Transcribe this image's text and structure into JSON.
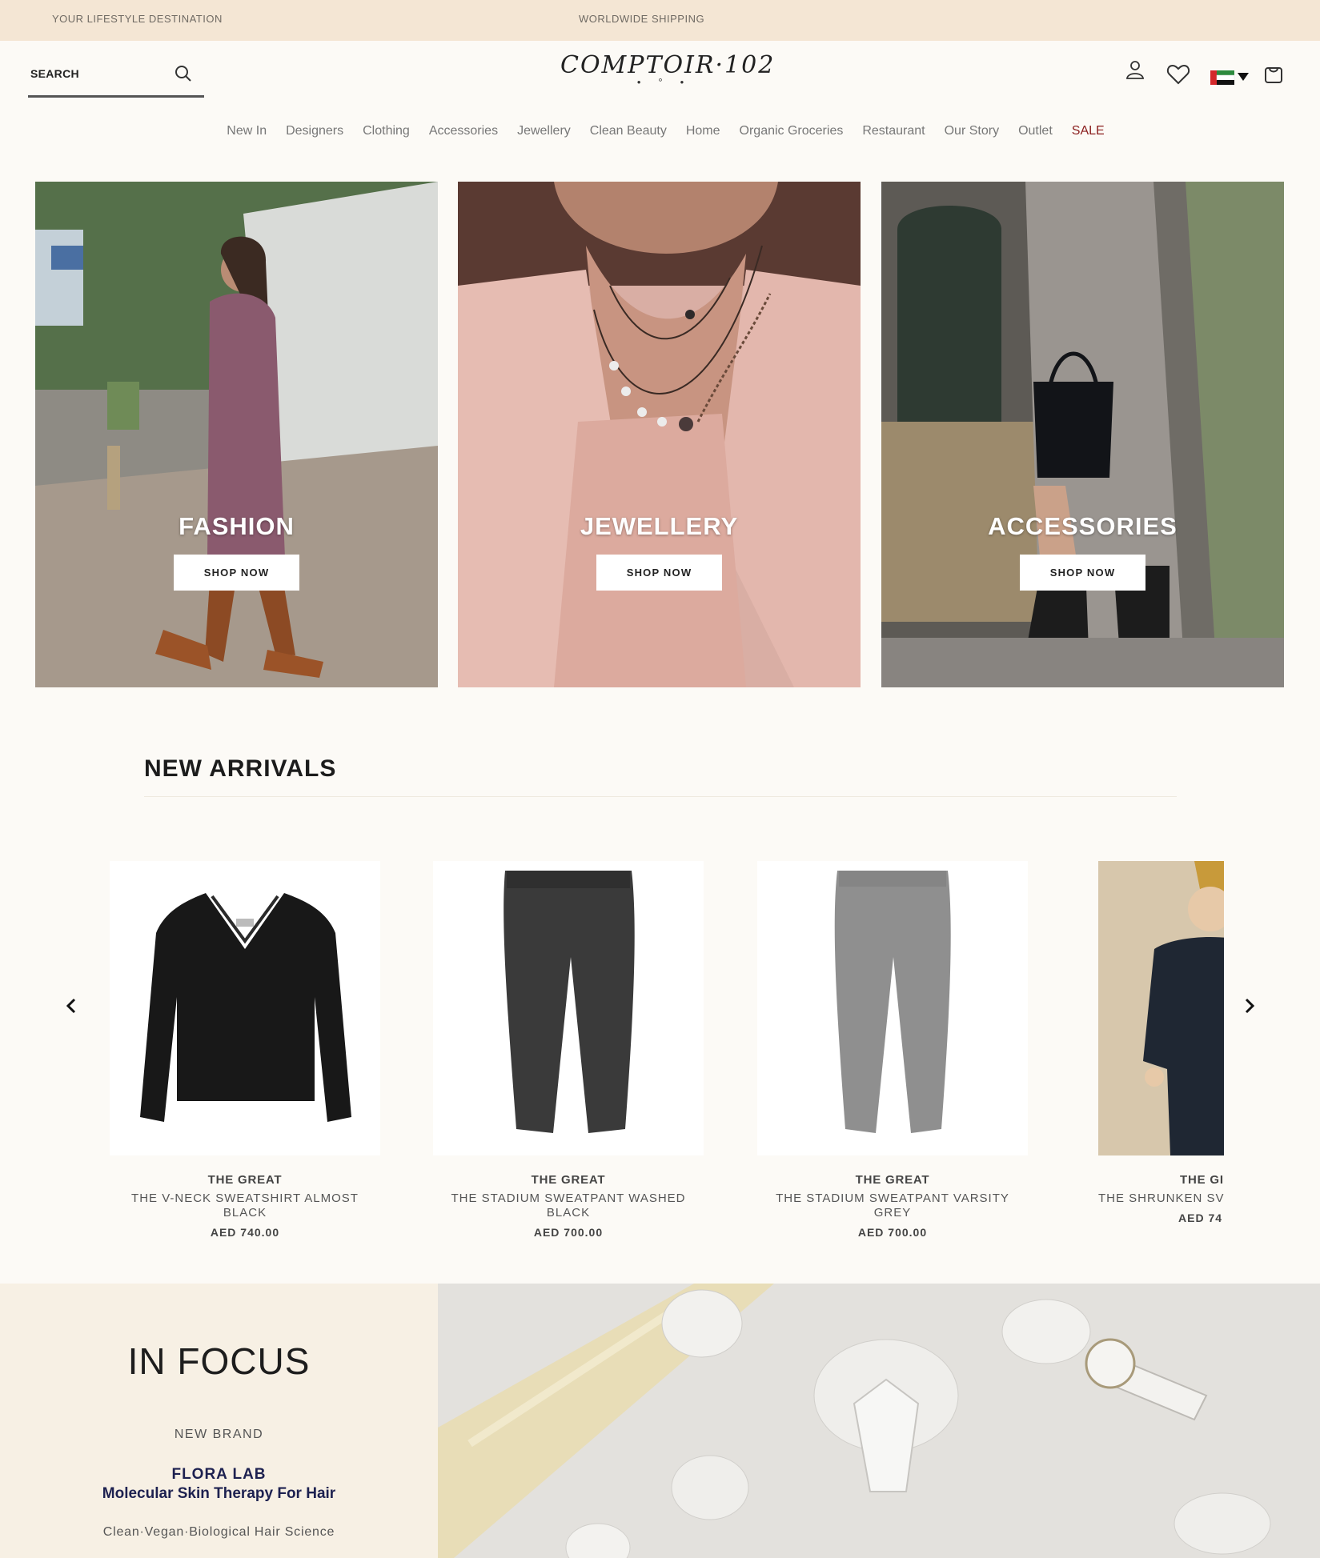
{
  "topbar": {
    "left": "YOUR LIFESTYLE DESTINATION",
    "center": "WORLDWIDE SHIPPING"
  },
  "header": {
    "search_label": "SEARCH",
    "logo": "COMPTOIR·102",
    "icons": [
      "account-icon",
      "wishlist-icon",
      "uae-flag-icon",
      "cart-icon"
    ]
  },
  "nav": [
    "New In",
    "Designers",
    "Clothing",
    "Accessories",
    "Jewellery",
    "Clean Beauty",
    "Home",
    "Organic Groceries",
    "Restaurant",
    "Our Story",
    "Outlet",
    "SALE"
  ],
  "banners": [
    {
      "title": "FASHION",
      "button": "SHOP NOW"
    },
    {
      "title": "JEWELLERY",
      "button": "SHOP NOW"
    },
    {
      "title": "ACCESSORIES",
      "button": "SHOP NOW"
    }
  ],
  "new_arrivals": {
    "title": "NEW ARRIVALS",
    "products": [
      {
        "brand": "THE GREAT",
        "name": "THE V-NECK SWEATSHIRT ALMOST BLACK",
        "price": "AED 740.00"
      },
      {
        "brand": "THE GREAT",
        "name": "THE STADIUM SWEATPANT WASHED BLACK",
        "price": "AED 700.00"
      },
      {
        "brand": "THE GREAT",
        "name": "THE STADIUM SWEATPANT VARSITY GREY",
        "price": "AED 700.00"
      },
      {
        "brand": "THE GI",
        "name": "THE SHRUNKEN SV NAV",
        "price": "AED 74"
      }
    ]
  },
  "in_focus": {
    "title": "IN FOCUS",
    "label": "NEW BRAND",
    "brand": "FLORA LAB",
    "subtitle": "Molecular Skin Therapy For Hair",
    "tagline": "Clean·Vegan·Biological Hair Science"
  },
  "colors": {
    "topbar": "#f4e6d4",
    "background": "#fcfaf6",
    "sale": "#8a1d1d",
    "focus_brand": "#1d2150"
  }
}
